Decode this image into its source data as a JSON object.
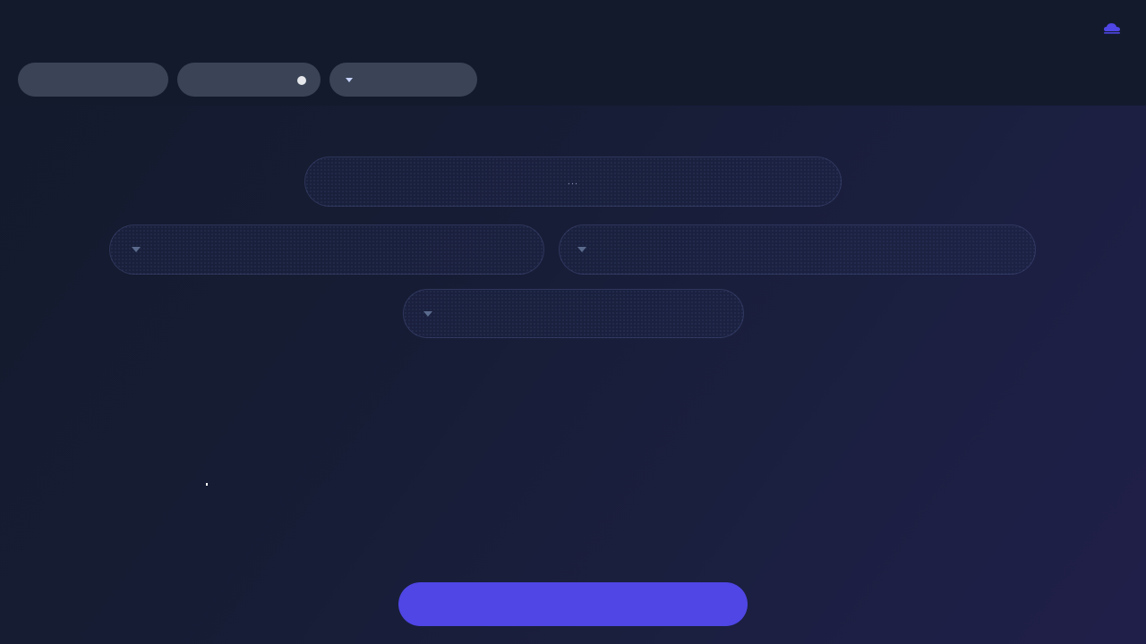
{
  "header": {
    "logo_icon": "cloud-logo-icon",
    "accent_color": "#4f46e5",
    "pill_1_label": "",
    "pill_2_label": "",
    "pill_2_toggle_state": "on",
    "pill_3_label": "",
    "pill_3_icon": "caret-down-icon"
  },
  "form": {
    "name_field_value": "...",
    "field_a_value": "",
    "field_a_icon": "caret-down-icon",
    "field_b_value": "",
    "field_b_icon": "caret-down-icon",
    "field_c_value": "",
    "field_c_icon": "caret-down-icon"
  },
  "actions": {
    "submit_label": ""
  }
}
